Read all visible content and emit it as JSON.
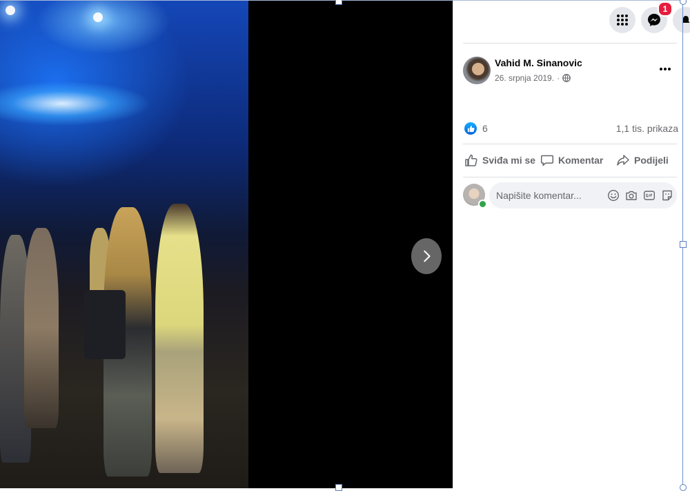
{
  "post": {
    "author": "Vahid M. Sinanovic",
    "date": "26. srpnja 2019.",
    "date_separator": "·",
    "reactions_count": "6",
    "views": "1,1 tis. prikaza"
  },
  "topbar": {
    "notification_count": "1"
  },
  "actions": {
    "like_label": "Sviđa mi se",
    "comment_label": "Komentar",
    "share_label": "Podijeli"
  },
  "comment": {
    "placeholder": "Napišite komentar..."
  },
  "colors": {
    "like_blue": "#0866ff",
    "badge_red": "#e41e3f",
    "online_green": "#31a24c"
  }
}
